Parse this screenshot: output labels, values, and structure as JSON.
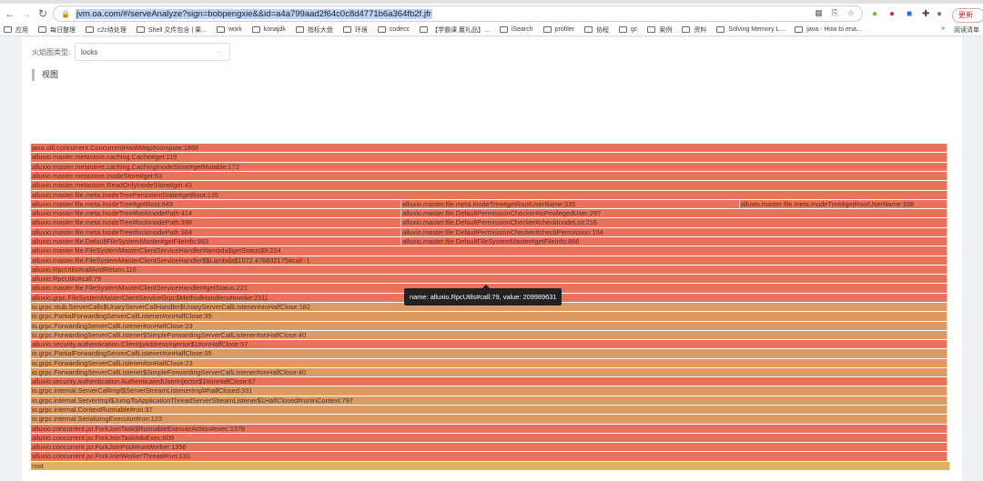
{
  "browser": {
    "url": "jvm.oa.com/#/serveAnalyze?sign=bobpengxie&&id=a4a799aad2f64c0c8d4771b6a364fb2f.jfr",
    "update_label": "更新",
    "bookmarks": [
      "应用",
      "每日整理",
      "c2c待处理",
      "Shell 文件包含 | 果...",
      "work",
      "konajdk",
      "指标大盘",
      "环境",
      "codecc",
      "【学霸课 赢礼品】...",
      "iSearch",
      "profiler",
      "协程",
      "gc",
      "案例",
      "资料",
      "Solving Memory L...",
      "java - How to ena..."
    ],
    "more_bookmarks": "»",
    "reading_list": "阅读清单"
  },
  "page": {
    "flame_type_label": "火焰图类型:",
    "flame_type_value": "locks",
    "view_title": "视图"
  },
  "tooltip": "name: alluxio.RpcUtils#call:79, value: 209989631",
  "colors": {
    "red": "#e8735a",
    "orange": "#dd9a62",
    "root": "#d9b465"
  },
  "flame": {
    "common": [
      "root",
      "alluxio.concurrent.jsr.ForkJoinWorkerThread#run:131",
      "alluxio.concurrent.jsr.ForkJoinPool#runWorker:1356",
      "alluxio.concurrent.jsr.ForkJoinTask#doExec:609",
      "alluxio.concurrent.jsr.ForkJoinTask$RunnableExecuteAction#exec:1378",
      "io.grpc.internal.SerializingExecutor#run:123",
      "io.grpc.internal.ContextRunnable#run:37",
      "io.grpc.internal.ServerImpl$JumpToApplicationThreadServerStreamListener$1HalfClosed#runInContext:797",
      "io.grpc.internal.ServerCallImpl$ServerStreamListenerImpl#halfClosed:331",
      "alluxio.security.authentication.AuthenticatedUserInjector$1#onHalfClose:67",
      "io.grpc.ForwardingServerCallListener$SimpleForwardingServerCallListener#onHalfClose:40",
      "io.grpc.ForwardingServerCallListener#onHalfClose:23",
      "io.grpc.PartialForwardingServerCallListener#onHalfClose:35",
      "alluxio.security.authentication.ClientIpAddressInjector$1#onHalfClose:57",
      "io.grpc.ForwardingServerCallListener$SimpleForwardingServerCallListener#onHalfClose:40",
      "io.grpc.ForwardingServerCallListener#onHalfClose:23",
      "io.grpc.PartialForwardingServerCallListener#onHalfClose:35",
      "io.grpc.stub.ServerCalls$UnaryServerCallHandler$UnaryServerCallListener#onHalfClose:182",
      "alluxio.grpc.FileSystemMasterClientServiceGrpc$MethodHandlers#invoke:2311",
      "alluxio.master.file.FileSystemMasterClientServiceHandler#getStatus:221",
      "alluxio.RpcUtils#call:79",
      "alluxio.RpcUtils#callAndReturn:116",
      "alluxio.master.file.FileSystemMasterClientServiceHandler$$Lambda$1072.476832175#call:-1",
      "alluxio.master.file.FileSystemMasterClientServiceHandler#lambda$getStatus$8:224"
    ],
    "stacks": [
      {
        "percent": 40.3,
        "frames": [
          "alluxio.master.file.DefaultFileSystemMaster#getFileInfo:863",
          "alluxio.master.file.meta.InodeTree#lockInodePath:384",
          "alluxio.master.file.meta.InodeTree#lockInodePath:398",
          "alluxio.master.file.meta.InodeTree#lockInodePath:414",
          "alluxio.master.file.meta.InodeTree#getRoot:649",
          "alluxio.master.file.meta.InodeTreePersistentState#getRoot:135",
          "alluxio.master.metastore.ReadOnlyInodeStore#get:43",
          "alluxio.master.metastore.InodeStore#get:63",
          "alluxio.master.metastore.caching.CachingInodeStore#getMutable:172",
          "alluxio.master.metastore.caching.Cache#get:119",
          "java.util.concurrent.ConcurrentHashMap#compute:1868"
        ]
      },
      {
        "percent": 36.8,
        "frames": [
          "alluxio.master.file.DefaultFileSystemMaster#getFileInfo:866",
          "alluxio.master.file.DefaultPermissionChecker#checkPermission:104",
          "alluxio.master.file.DefaultPermissionChecker#checkInodeList:216",
          "alluxio.master.file.DefaultPermissionChecker#isPrivilegedUser:297",
          "alluxio.master.file.meta.InodeTree#getRootUserName:335",
          "alluxio.master.file.meta.InodeTreePersistentState#getRoot:135",
          "alluxio.master.metastore.ReadOnlyInodeStore#get:43",
          "alluxio.master.metastore.InodeStore#get:63",
          "alluxio.master.metastore.caching.CachingInodeStore#getMutable:172",
          "alluxio.master.metastore.caching.Cache#get:119",
          "java.util.concurrent.ConcurrentHashMap#compute:1868"
        ]
      },
      {
        "percent": 22.6,
        "frames": [
          "alluxio.master.file.DefaultFileSystemMaster#getFileInfo:866",
          "alluxio.master.file.DefaultPermissionChecker#checkPermission:104",
          "alluxio.master.file.DefaultPermissionChecker#checkInodeList:216",
          "alluxio.master.file.DefaultPermissionChecker#isPrivilegedUser:297",
          "alluxio.master.file.meta.InodeTree#getRootUserName:338",
          "alluxio.master.file.meta.InodeTreePersistentState#getRoot:135",
          "alluxio.master.metastore.ReadOnlyInodeStore#get:43",
          "alluxio.master.metastore.InodeStore#get:63",
          "alluxio.master.metastore.caching.CachingInodeStore#getMutable:172",
          "alluxio.master.metastore.caching.Cache#get:119",
          "java.util.concurrent.ConcurrentHashMap#compute:1868"
        ]
      }
    ]
  }
}
